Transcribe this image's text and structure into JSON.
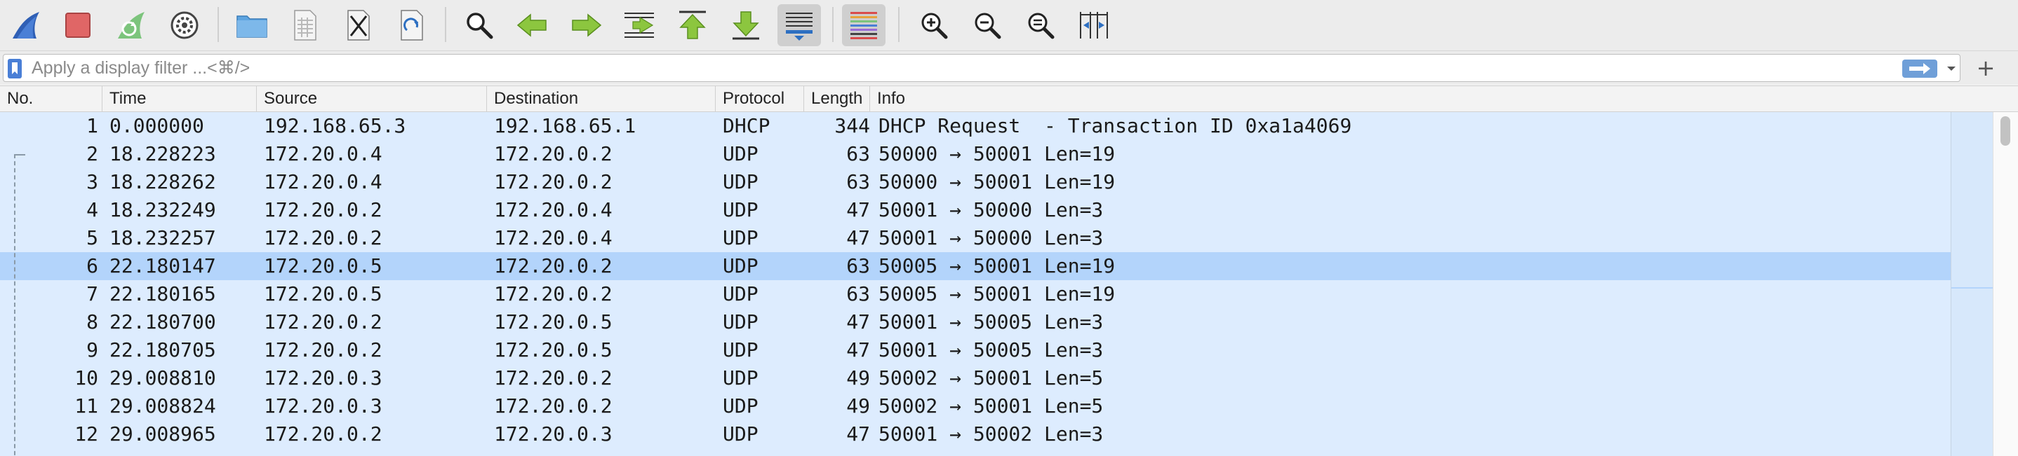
{
  "toolbar": {
    "buttons": [
      {
        "name": "start-capture-icon",
        "pressed": false
      },
      {
        "name": "stop-capture-icon",
        "pressed": false
      },
      {
        "name": "restart-capture-icon",
        "pressed": false
      },
      {
        "name": "capture-options-icon",
        "pressed": false
      },
      {
        "name": "open-file-icon",
        "pressed": false
      },
      {
        "name": "save-file-icon",
        "pressed": false
      },
      {
        "name": "close-file-icon",
        "pressed": false
      },
      {
        "name": "reload-file-icon",
        "pressed": false
      },
      {
        "name": "find-packet-icon",
        "pressed": false
      },
      {
        "name": "go-back-icon",
        "pressed": false
      },
      {
        "name": "go-forward-icon",
        "pressed": false
      },
      {
        "name": "go-to-packet-icon",
        "pressed": false
      },
      {
        "name": "go-to-first-packet-icon",
        "pressed": false
      },
      {
        "name": "go-to-last-packet-icon",
        "pressed": false
      },
      {
        "name": "auto-scroll-icon",
        "pressed": true
      },
      {
        "name": "colorize-icon",
        "pressed": true
      },
      {
        "name": "zoom-in-icon",
        "pressed": false
      },
      {
        "name": "zoom-out-icon",
        "pressed": false
      },
      {
        "name": "normal-size-icon",
        "pressed": false
      },
      {
        "name": "resize-columns-icon",
        "pressed": false
      }
    ]
  },
  "filter": {
    "placeholder": "Apply a display filter ...<⌘/>",
    "value": "",
    "add_label": "+"
  },
  "columns": [
    "No.",
    "Time",
    "Source",
    "Destination",
    "Protocol",
    "Length",
    "Info"
  ],
  "packets": [
    {
      "no": "1",
      "time": "0.000000",
      "source": "192.168.65.3",
      "destination": "192.168.65.1",
      "protocol": "DHCP",
      "length": "344",
      "info": "DHCP Request  - Transaction ID 0xa1a4069"
    },
    {
      "no": "2",
      "time": "18.228223",
      "source": "172.20.0.4",
      "destination": "172.20.0.2",
      "protocol": "UDP",
      "length": "63",
      "info": "50000 → 50001 Len=19"
    },
    {
      "no": "3",
      "time": "18.228262",
      "source": "172.20.0.4",
      "destination": "172.20.0.2",
      "protocol": "UDP",
      "length": "63",
      "info": "50000 → 50001 Len=19"
    },
    {
      "no": "4",
      "time": "18.232249",
      "source": "172.20.0.2",
      "destination": "172.20.0.4",
      "protocol": "UDP",
      "length": "47",
      "info": "50001 → 50000 Len=3"
    },
    {
      "no": "5",
      "time": "18.232257",
      "source": "172.20.0.2",
      "destination": "172.20.0.4",
      "protocol": "UDP",
      "length": "47",
      "info": "50001 → 50000 Len=3"
    },
    {
      "no": "6",
      "time": "22.180147",
      "source": "172.20.0.5",
      "destination": "172.20.0.2",
      "protocol": "UDP",
      "length": "63",
      "info": "50005 → 50001 Len=19",
      "selected": true
    },
    {
      "no": "7",
      "time": "22.180165",
      "source": "172.20.0.5",
      "destination": "172.20.0.2",
      "protocol": "UDP",
      "length": "63",
      "info": "50005 → 50001 Len=19"
    },
    {
      "no": "8",
      "time": "22.180700",
      "source": "172.20.0.2",
      "destination": "172.20.0.5",
      "protocol": "UDP",
      "length": "47",
      "info": "50001 → 50005 Len=3"
    },
    {
      "no": "9",
      "time": "22.180705",
      "source": "172.20.0.2",
      "destination": "172.20.0.5",
      "protocol": "UDP",
      "length": "47",
      "info": "50001 → 50005 Len=3"
    },
    {
      "no": "10",
      "time": "29.008810",
      "source": "172.20.0.3",
      "destination": "172.20.0.2",
      "protocol": "UDP",
      "length": "49",
      "info": "50002 → 50001 Len=5"
    },
    {
      "no": "11",
      "time": "29.008824",
      "source": "172.20.0.3",
      "destination": "172.20.0.2",
      "protocol": "UDP",
      "length": "49",
      "info": "50002 → 50001 Len=5"
    },
    {
      "no": "12",
      "time": "29.008965",
      "source": "172.20.0.2",
      "destination": "172.20.0.3",
      "protocol": "UDP",
      "length": "47",
      "info": "50001 → 50002 Len=3"
    }
  ],
  "colors": {
    "row_background": "#ddecfe",
    "selected_row": "#b3d4fb",
    "apply_button": "#6f9fd8"
  }
}
